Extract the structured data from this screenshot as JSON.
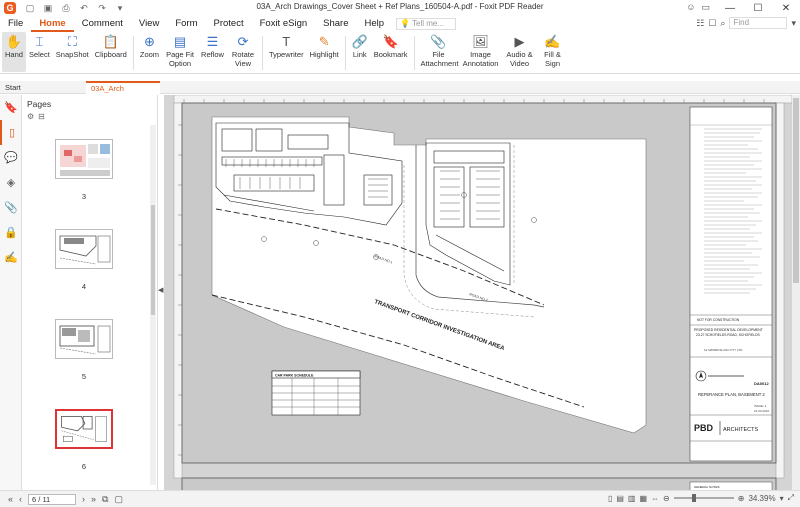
{
  "app": {
    "title": "03A_Arch Drawings_Cover Sheet + Ref Plans_160504-A.pdf - Foxit PDF Reader",
    "logo": "G"
  },
  "quick_access": [
    "open-icon",
    "save-icon",
    "print-icon",
    "undo-icon",
    "redo-icon",
    "dropdown-icon"
  ],
  "menu": {
    "items": [
      "File",
      "Home",
      "Comment",
      "View",
      "Form",
      "Protect",
      "Foxit eSign",
      "Share",
      "Help"
    ],
    "active": "Home",
    "tell_me": "Tell me...",
    "find": "Find"
  },
  "ribbon": {
    "buttons": [
      {
        "label": "Hand",
        "icon": "hand-icon"
      },
      {
        "label": "Select",
        "icon": "select-icon"
      },
      {
        "label": "SnapShot",
        "icon": "snapshot-icon"
      },
      {
        "label": "Clipboard",
        "icon": "clipboard-icon"
      },
      {
        "label": "Zoom",
        "icon": "zoom-icon"
      },
      {
        "label": "Page Fit Option",
        "icon": "page-fit-icon"
      },
      {
        "label": "Reflow",
        "icon": "reflow-icon"
      },
      {
        "label": "Rotate View",
        "icon": "rotate-icon"
      },
      {
        "label": "Typewriter",
        "icon": "typewriter-icon"
      },
      {
        "label": "Highlight",
        "icon": "highlight-icon"
      },
      {
        "label": "Link",
        "icon": "link-icon"
      },
      {
        "label": "Bookmark",
        "icon": "bookmark-icon"
      },
      {
        "label": "File Attachment",
        "icon": "file-attachment-icon"
      },
      {
        "label": "Image Annotation",
        "icon": "image-annotation-icon"
      },
      {
        "label": "Audio & Video",
        "icon": "audio-video-icon"
      },
      {
        "label": "Fill & Sign",
        "icon": "fill-sign-icon"
      }
    ]
  },
  "tabs": {
    "start": "Start",
    "doc": "03A_Arch Drawings_C..."
  },
  "pages_panel": {
    "title": "Pages",
    "thumbnails": [
      "3",
      "4",
      "5",
      "6"
    ],
    "selected": "6"
  },
  "drawing": {
    "corridor_label": "TRANSPORT CORRIDOR INVESTIGATION AREA",
    "road_label_1": "ROAD NO.1",
    "road_label_2": "ROAD NO.2",
    "schedule_title": "CAR PARK SCHEDULE",
    "not_for_construction": "NOT FOR CONSTRUCTION",
    "project_title": "PROPOSED RESIDENTIAL DEVELOPMENT",
    "project_address": "23-27 SCHOFIELDS ROAD, SCHOFIELDS",
    "client": "for MINIMUSH INC PTY LTD",
    "drawing_number": "DA0012",
    "drawing_title": "REFERANCE PLAN, BASEMENT 2",
    "issue": "ISSUE: 4",
    "date": "21.04.2016",
    "firm_logo": "PBD",
    "firm_name": "ARCHITECTS",
    "general_notes": "GENERAL NOTES:"
  },
  "status": {
    "page_indicator": "6 / 11",
    "zoom": "34.39%"
  }
}
